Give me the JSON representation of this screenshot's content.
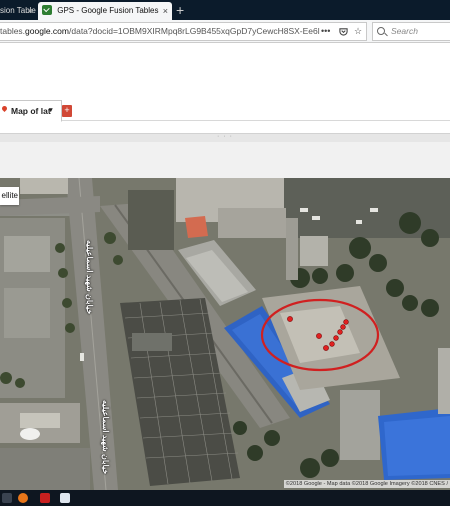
{
  "browser": {
    "tabs": [
      {
        "label": "sion Tables"
      },
      {
        "label": "GPS - Google Fusion Tables",
        "active": true
      }
    ],
    "new_tab": "+",
    "close_glyph": "×",
    "url_prefix": "tables.",
    "url_domain": "google.com",
    "url_rest": "/data?docid=1OBM9XIRMpq8rLG9B455xqGpD7yCewcH8SX-Ee6l",
    "search_placeholder": "Search",
    "icons": [
      "menu-dots-icon",
      "pocket-icon",
      "bookmark-star-icon",
      "search-icon"
    ]
  },
  "fusion": {
    "map_tab_label": "Map of lat",
    "map_tab_caret": "▾",
    "add_tab_label": "+",
    "splitter_dots": "· · ·"
  },
  "map": {
    "satellite_label": "ellite",
    "street_labels": [
      "خیابان شهید اسماعیلیه",
      "خیابان شهید اسماعیلیه",
      "خیابان شهید اسماعیلیه"
    ],
    "attribution": "©2018 Google - Map data ©2018 Google Imagery ©2018 CNES /",
    "marker_color": "#e02020",
    "circle_color": "#d02020"
  },
  "taskbar": {
    "icons": [
      "firefox-icon",
      "adobe-pdf-icon",
      "app-icon"
    ]
  }
}
